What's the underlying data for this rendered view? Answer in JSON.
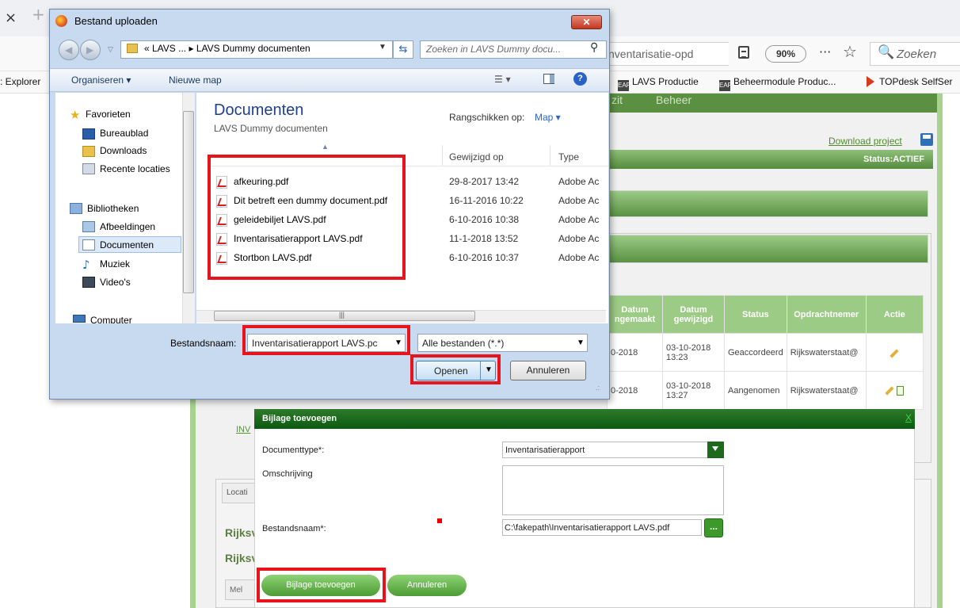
{
  "browser": {
    "tab_close": "×",
    "tab_new": "+",
    "url_text": "nventarisatie-opd",
    "zoom": "90%",
    "more": "···",
    "star": "☆",
    "search_icon": "🔍",
    "search_placeholder": "Zoeken",
    "bookmarks": [
      {
        "label": ": Explorer",
        "icon": "none"
      },
      {
        "label": "LAVS Productie",
        "icon": "eap-icon"
      },
      {
        "label": "Beheermodule Produc...",
        "icon": "eap-icon"
      },
      {
        "label": "TOPdesk SelfSer",
        "icon": "topdesk-arrow-icon"
      }
    ]
  },
  "page": {
    "nav_partial": "zit",
    "nav_beheer": "Beheer",
    "download_link": "Download project",
    "status": "Status:ACTIEF",
    "table": {
      "headers": [
        "Datum\nngemaakt",
        "Datum\ngewijzigd",
        "Status",
        "Opdrachtnemer",
        "Actie"
      ],
      "rows": [
        [
          "0-2018",
          "03-10-2018\n13:23",
          "Geaccordeerd",
          "Rijkswaterstaat@",
          "pencil"
        ],
        [
          "0-2018",
          "03-10-2018\n13:27",
          "Aangenomen",
          "Rijkswaterstaat@",
          "pencil+doc"
        ]
      ]
    },
    "inv_link": "INV",
    "location_tab": "Locati",
    "rijks_1": "Rijksv",
    "rijks_2": "Rijksv",
    "mel_tab": "Mel"
  },
  "modal": {
    "title": "Bijlage toevoegen",
    "close": "X",
    "doctype_label": "Documenttype*:",
    "doctype_value": "Inventarisatierapport",
    "omschrijving_label": "Omschrijving",
    "bestandsnaam_label": "Bestandsnaam*:",
    "bestandsnaam_value": "C:\\fakepath\\Inventarisatierapport LAVS.pdf",
    "browse": "...",
    "add_button": "Bijlage toevoegen",
    "cancel_button": "Annuleren"
  },
  "dialog": {
    "title": "Bestand uploaden",
    "close": "✕",
    "address": "« LAVS ...  ▸  LAVS Dummy documenten",
    "search_placeholder": "Zoeken in LAVS Dummy docu...",
    "organize": "Organiseren ▾",
    "new_folder": "Nieuwe map",
    "nav": {
      "favorites": "Favorieten",
      "desktop": "Bureaublad",
      "downloads": "Downloads",
      "recent": "Recente locaties",
      "libraries": "Bibliotheken",
      "pictures": "Afbeeldingen",
      "documents": "Documenten",
      "music": "Muziek",
      "videos": "Video's",
      "computer": "Computer"
    },
    "library_title": "Documenten",
    "library_subtitle": "LAVS Dummy documenten",
    "arrange_label": "Rangschikken op:",
    "arrange_value": "Map ▾",
    "columns": {
      "modified": "Gewijzigd op",
      "type": "Type"
    },
    "files": [
      {
        "name": "afkeuring.pdf",
        "date": "29-8-2017 13:42",
        "type": "Adobe Ac"
      },
      {
        "name": "Dit betreft een dummy document.pdf",
        "date": "16-11-2016 10:22",
        "type": "Adobe Ac"
      },
      {
        "name": "geleidebiljet LAVS.pdf",
        "date": "6-10-2016 10:38",
        "type": "Adobe Ac"
      },
      {
        "name": "Inventarisatierapport LAVS.pdf",
        "date": "11-1-2018 13:52",
        "type": "Adobe Ac"
      },
      {
        "name": "Stortbon LAVS.pdf",
        "date": "6-10-2016 10:37",
        "type": "Adobe Ac"
      }
    ],
    "filename_label": "Bestandsnaam:",
    "filename_value": "Inventarisatierapport LAVS.pc",
    "filter_value": "Alle bestanden (*.*)",
    "open_button": "Openen",
    "cancel_button": "Annuleren"
  },
  "colors": {
    "highlight": "#e8141c",
    "brand_green": "#5b8f42",
    "modal_header": "#0a5a10"
  }
}
